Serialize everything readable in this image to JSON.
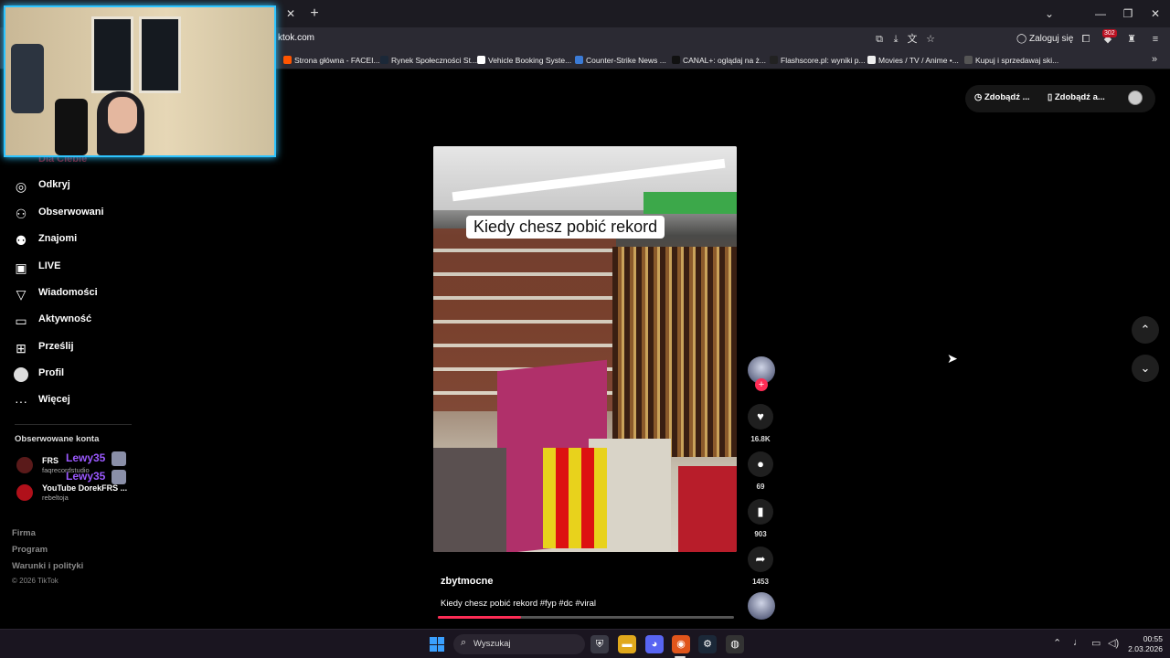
{
  "browser": {
    "url": "ktok.com",
    "login_label": "Zaloguj się",
    "badge_count": "302",
    "bookmarks": [
      {
        "label": "Strona główna - FACEI...",
        "color": "#ff5500"
      },
      {
        "label": "Rynek Społeczności St...",
        "color": "#1b2838"
      },
      {
        "label": "Vehicle Booking Syste...",
        "color": "#ffffff"
      },
      {
        "label": "Counter-Strike News ...",
        "color": "#3b7bd6"
      },
      {
        "label": "CANAL+: oglądaj na ż...",
        "color": "#111111"
      },
      {
        "label": "Flashscore.pl: wyniki p...",
        "color": "#222222"
      },
      {
        "label": "Movies / TV / Anime •...",
        "color": "#eeeeee"
      },
      {
        "label": "Kupuj i sprzedawaj ski...",
        "color": "#555555"
      }
    ]
  },
  "sidebar": {
    "partial_item": "Dla Ciebie",
    "items": [
      {
        "label": "Odkryj",
        "icon": "compass-icon"
      },
      {
        "label": "Obserwowani",
        "icon": "person-follow-icon"
      },
      {
        "label": "Znajomi",
        "icon": "friends-icon"
      },
      {
        "label": "LIVE",
        "icon": "live-tv-icon"
      },
      {
        "label": "Wiadomości",
        "icon": "paper-plane-icon"
      },
      {
        "label": "Aktywność",
        "icon": "activity-icon"
      },
      {
        "label": "Prześlij",
        "icon": "upload-plus-icon"
      },
      {
        "label": "Profil",
        "icon": "profile-avatar"
      },
      {
        "label": "Więcej",
        "icon": "more-dots-icon"
      }
    ],
    "followed_title": "Obserwowane konta",
    "followed": [
      {
        "name": "FRS",
        "handle": "faqrecordstudio",
        "color": "#5a1a1a"
      },
      {
        "name": "YouTube DorekFRS ...",
        "handle": "rebeltoja",
        "color": "#b0101a"
      }
    ],
    "overlay_name": "Lewy35",
    "footer": [
      "Firma",
      "Program",
      "Warunki i polityki"
    ],
    "copyright": "© 2026 TikTok"
  },
  "top_right": {
    "pill1": "Zdobądź ...",
    "pill2": "Zdobądź a..."
  },
  "video": {
    "caption_overlay": "Kiedy chesz pobić rekord",
    "author": "zbytmocne",
    "description": "Kiedy chesz pobić rekord #fyp #dc #viral",
    "progress": 0.28,
    "likes": "16.8K",
    "comments": "69",
    "saves": "903",
    "shares": "1453"
  },
  "taskbar": {
    "search_label": "Wyszukaj",
    "time": "00:55",
    "date": "2.03.2026"
  }
}
